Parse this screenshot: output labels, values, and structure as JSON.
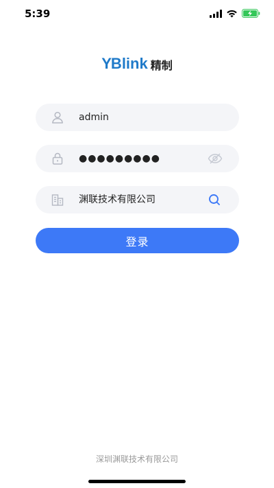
{
  "status_bar": {
    "time": "5:39"
  },
  "logo": {
    "mark_prefix": "YB",
    "mark_suffix": "link",
    "suffix_text": "精制"
  },
  "login": {
    "username_value": "admin",
    "password_masked": "●●●●●●●●●",
    "company_value": "渊联技术有限公司",
    "submit_label": "登录"
  },
  "footer": {
    "company": "深圳渊联技术有限公司"
  },
  "colors": {
    "accent": "#3d79f7",
    "logo_blue": "#1f7ac9",
    "field_bg": "#f4f5f8",
    "battery_green": "#34c759"
  },
  "icons": {
    "user": "user-icon",
    "lock": "lock-icon",
    "building": "building-icon",
    "eye_off": "eye-off-icon",
    "search": "search-icon"
  }
}
